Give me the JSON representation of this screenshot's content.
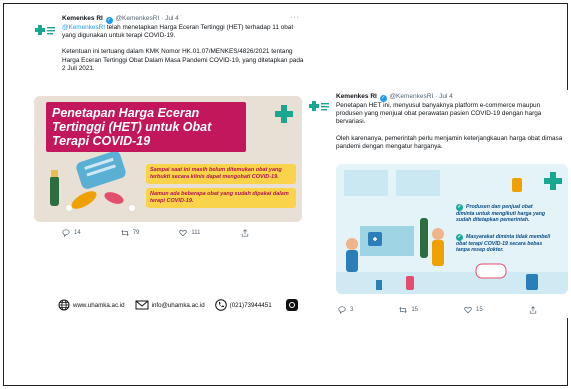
{
  "tweets": [
    {
      "author": "Kemenkes RI",
      "handle": "@KemenkesRI",
      "separator": "·",
      "date": "Jul 4",
      "more": "···",
      "paragraph1_mention": "@KemenkesRI",
      "paragraph1_rest": " telah menetapkan Harga Eceran Tertinggi (HET) terhadap 11 obat yang digunakan untuk terapi COVID-19.",
      "paragraph2": "Ketentuan ini tertuang dalam KMK Nomor HK.01.07/MENKES/4826/2021 tentang Harga Eceran Tertinggi Obat Dalam Masa Pandemi COVID-19, yang ditetapkan pada 2 Juli 2021.",
      "card": {
        "title": "Penetapan Harga Eceran Tertinggi (HET) untuk Obat Terapi COVID-19",
        "note1": "Sampai saat ini masih belum ditemukan obat yang terbukti secara klinis dapat mengobati COVID-19.",
        "note2": "Namun ada beberapa obat yang sudah dipakai dalam terapi COVID-19."
      },
      "actions": {
        "replies": "14",
        "retweets": "79",
        "likes": "111"
      }
    },
    {
      "author": "Kemenkes RI",
      "handle": "@KemenkesRI",
      "separator": "·",
      "date": "Jul 4",
      "paragraph1": "Penetapan HET ini, menyusul banyaknya platform e-commerce maupun produsen yang menjual obat perawatan pasien COVID-19 dengan harga bervariasi.",
      "paragraph2": "Oleh karenanya, pemerintah perlu menjamin keterjangkauan harga obat dimasa pandemi dengan mengatur harganya.",
      "card": {
        "bullet1": "Produsen dan penjual obat diminta untuk mengikuti harga yang sudah ditetapkan pemerintah.",
        "bullet2": "Masyarakat diminta tidak membeli obat terapi COVID-19 secara bebas tanpa resep dokter."
      },
      "actions": {
        "replies": "3",
        "retweets": "15",
        "likes": "15"
      }
    }
  ],
  "footer": {
    "website": "www.uhamka.ac.id",
    "email": "info@uhamka.ac.id",
    "phone": "(021)73944451"
  },
  "colors": {
    "accent_blue": "#1d9bf0",
    "poster_magenta": "#c2185b",
    "poster_yellow": "#f9d34a",
    "poster2_bg": "#e3f3f8"
  },
  "icons": [
    "kemenkes-logo-icon",
    "verified-icon",
    "more-icon",
    "reply-icon",
    "retweet-icon",
    "like-icon",
    "share-icon",
    "globe-icon",
    "mail-icon",
    "phone-icon",
    "instagram-icon"
  ]
}
